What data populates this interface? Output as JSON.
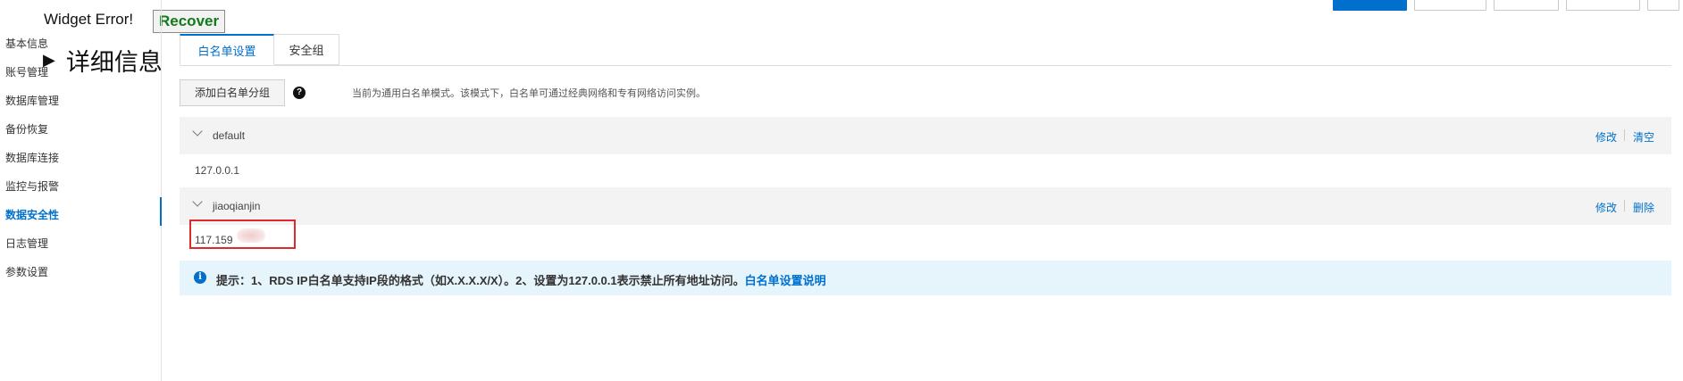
{
  "widget_error": {
    "message": "Widget Error!",
    "recover_label": "Recover",
    "details_label": "详细信息"
  },
  "sidebar": {
    "items": [
      {
        "label": "基本信息"
      },
      {
        "label": "账号管理"
      },
      {
        "label": "数据库管理"
      },
      {
        "label": "备份恢复"
      },
      {
        "label": "数据库连接"
      },
      {
        "label": "监控与报警"
      },
      {
        "label": "数据安全性",
        "active": true
      },
      {
        "label": "日志管理"
      },
      {
        "label": "参数设置"
      }
    ]
  },
  "tabs": [
    {
      "label": "白名单设置",
      "active": true
    },
    {
      "label": "安全组"
    }
  ],
  "toolbar": {
    "add_group_label": "添加白名单分组",
    "help_icon": "question-icon",
    "mode_description": "当前为通用白名单模式。该模式下，白名单可通过经典网络和专有网络访问实例。"
  },
  "groups": [
    {
      "name": "default",
      "ips": "127.0.0.1",
      "actions": [
        "修改",
        "清空"
      ]
    },
    {
      "name": "jiaoqianjin",
      "ips": "117.159",
      "actions": [
        "修改",
        "删除"
      ]
    }
  ],
  "tip": {
    "text": "提示：1、RDS IP白名单支持IP段的格式（如X.X.X.X/X）。2、设置为127.0.0.1表示禁止所有地址访问。",
    "link_label": "白名单设置说明"
  },
  "colors": {
    "accent": "#0070cc",
    "highlight": "#e0292b",
    "tip_background": "#e6f4fc"
  }
}
